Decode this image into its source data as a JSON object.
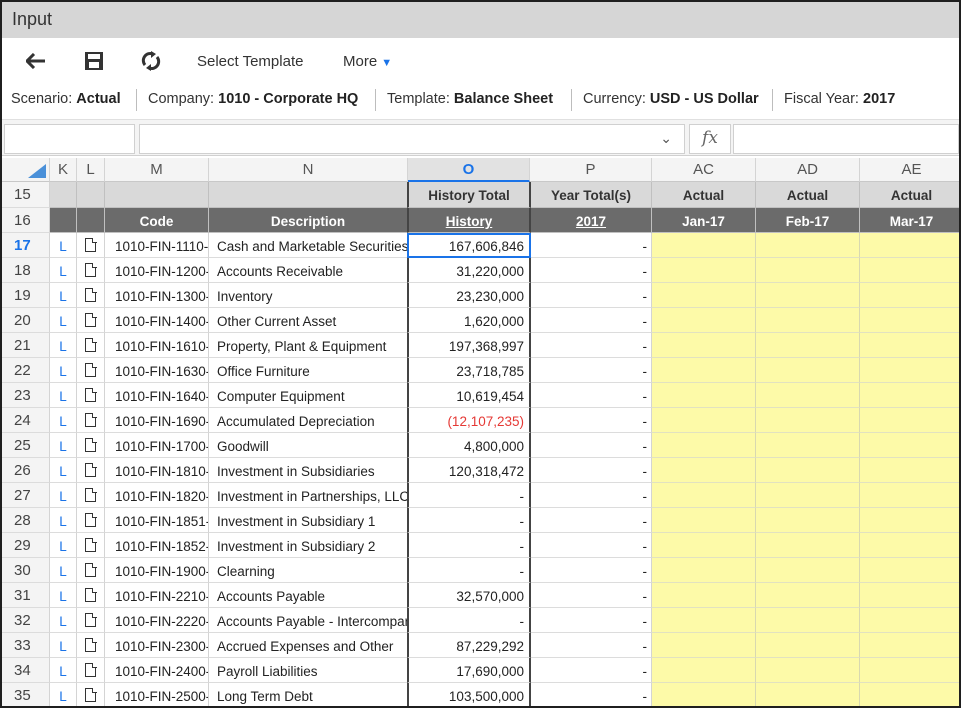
{
  "window": {
    "title": "Input"
  },
  "toolbar": {
    "back_icon": "back-arrow-icon",
    "save_icon": "save-icon",
    "refresh_icon": "refresh-icon",
    "select_template_label": "Select Template",
    "more_label": "More"
  },
  "info": {
    "scenario_label": "Scenario:",
    "scenario_value": "Actual",
    "company_label": "Company:",
    "company_value": "1010 - Corporate HQ",
    "template_label": "Template:",
    "template_value": "Balance Sheet",
    "currency_label": "Currency:",
    "currency_value": "USD - US Dollar",
    "fiscal_label": "Fiscal Year:",
    "fiscal_value": "2017"
  },
  "formula_bar": {
    "name_box": "",
    "formula": "",
    "fx_label": "fx"
  },
  "columns": [
    "K",
    "L",
    "M",
    "N",
    "O",
    "P",
    "AC",
    "AD",
    "AE"
  ],
  "header_rows": {
    "row15": {
      "num": "15",
      "O": "History Total",
      "P": "Year Total(s)",
      "AC": "Actual",
      "AD": "Actual",
      "AE": "Actual"
    },
    "row16": {
      "num": "16",
      "M": "Code",
      "N": "Description",
      "O": "History",
      "P": "2017",
      "AC": "Jan-17",
      "AD": "Feb-17",
      "AE": "Mar-17"
    }
  },
  "rows": [
    {
      "num": "17",
      "k": "L",
      "code": "1010-FIN-1110-",
      "desc": "Cash and Marketable Securities",
      "history": "167,606,846",
      "year": "-"
    },
    {
      "num": "18",
      "k": "L",
      "code": "1010-FIN-1200-",
      "desc": "Accounts Receivable",
      "history": "31,220,000",
      "year": "-"
    },
    {
      "num": "19",
      "k": "L",
      "code": "1010-FIN-1300-",
      "desc": "Inventory",
      "history": "23,230,000",
      "year": "-"
    },
    {
      "num": "20",
      "k": "L",
      "code": "1010-FIN-1400-",
      "desc": "Other Current Asset",
      "history": "1,620,000",
      "year": "-"
    },
    {
      "num": "21",
      "k": "L",
      "code": "1010-FIN-1610-",
      "desc": "Property, Plant & Equipment",
      "history": "197,368,997",
      "year": "-"
    },
    {
      "num": "22",
      "k": "L",
      "code": "1010-FIN-1630-",
      "desc": "Office Furniture",
      "history": "23,718,785",
      "year": "-"
    },
    {
      "num": "23",
      "k": "L",
      "code": "1010-FIN-1640-",
      "desc": "Computer Equipment",
      "history": "10,619,454",
      "year": "-"
    },
    {
      "num": "24",
      "k": "L",
      "code": "1010-FIN-1690-",
      "desc": "Accumulated Depreciation",
      "history": "(12,107,235)",
      "year": "-"
    },
    {
      "num": "25",
      "k": "L",
      "code": "1010-FIN-1700-",
      "desc": "Goodwill",
      "history": "4,800,000",
      "year": "-"
    },
    {
      "num": "26",
      "k": "L",
      "code": "1010-FIN-1810-",
      "desc": "Investment in Subsidiaries",
      "history": "120,318,472",
      "year": "-"
    },
    {
      "num": "27",
      "k": "L",
      "code": "1010-FIN-1820-",
      "desc": "Investment in Partnerships, LLC",
      "history": "-",
      "year": "-"
    },
    {
      "num": "28",
      "k": "L",
      "code": "1010-FIN-1851-",
      "desc": "Investment in Subsidiary 1",
      "history": "-",
      "year": "-"
    },
    {
      "num": "29",
      "k": "L",
      "code": "1010-FIN-1852-",
      "desc": "Investment in Subsidiary 2",
      "history": "-",
      "year": "-"
    },
    {
      "num": "30",
      "k": "L",
      "code": "1010-FIN-1900-",
      "desc": "Clearning",
      "history": "-",
      "year": "-"
    },
    {
      "num": "31",
      "k": "L",
      "code": "1010-FIN-2210-",
      "desc": "Accounts Payable",
      "history": "32,570,000",
      "year": "-"
    },
    {
      "num": "32",
      "k": "L",
      "code": "1010-FIN-2220-",
      "desc": "Accounts Payable - Intercompar",
      "history": "-",
      "year": "-"
    },
    {
      "num": "33",
      "k": "L",
      "code": "1010-FIN-2300-",
      "desc": "Accrued Expenses and Other",
      "history": "87,229,292",
      "year": "-"
    },
    {
      "num": "34",
      "k": "L",
      "code": "1010-FIN-2400-",
      "desc": "Payroll Liabilities",
      "history": "17,690,000",
      "year": "-"
    },
    {
      "num": "35",
      "k": "L",
      "code": "1010-FIN-2500-",
      "desc": "Long Term Debt",
      "history": "103,500,000",
      "year": "-"
    }
  ],
  "colors": {
    "accent": "#1a73e8",
    "negative": "#e53935",
    "input_cell": "#fdfaa8",
    "header_dark": "#6b6b6b"
  }
}
